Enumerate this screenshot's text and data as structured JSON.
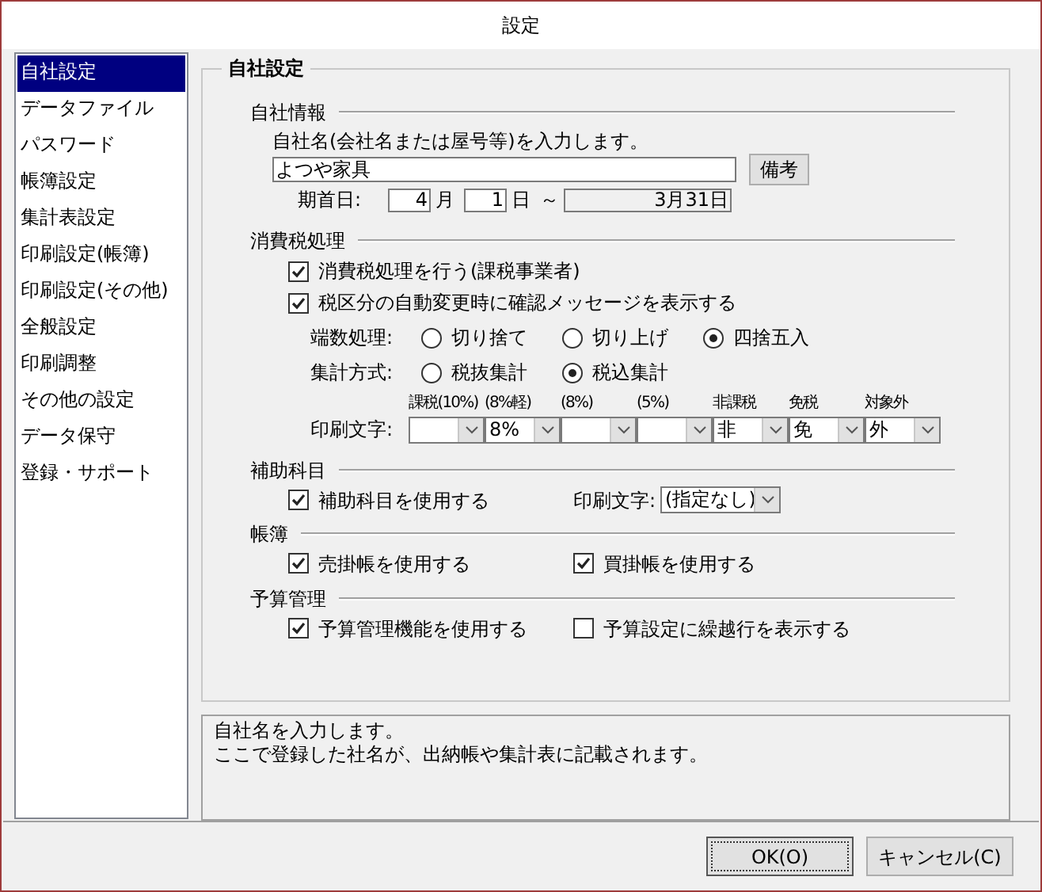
{
  "window": {
    "title": "設定"
  },
  "sidebar": {
    "items": [
      {
        "label": "自社設定",
        "selected": true
      },
      {
        "label": "データファイル",
        "selected": false
      },
      {
        "label": "パスワード",
        "selected": false
      },
      {
        "label": "帳簿設定",
        "selected": false
      },
      {
        "label": "集計表設定",
        "selected": false
      },
      {
        "label": "印刷設定(帳簿)",
        "selected": false
      },
      {
        "label": "印刷設定(その他)",
        "selected": false
      },
      {
        "label": "全般設定",
        "selected": false
      },
      {
        "label": "印刷調整",
        "selected": false
      },
      {
        "label": "その他の設定",
        "selected": false
      },
      {
        "label": "データ保守",
        "selected": false
      },
      {
        "label": "登録・サポート",
        "selected": false
      }
    ]
  },
  "panel": {
    "title": "自社設定",
    "company_info": {
      "heading": "自社情報",
      "prompt": "自社名(会社名または屋号等)を入力します。",
      "name_value": "よつや家具",
      "notes_button": "備考",
      "period_label": "期首日:",
      "start_month": "4",
      "month_unit": "月",
      "start_day": "1",
      "day_unit": "日",
      "tilde": "～",
      "end_date": "3月31日"
    },
    "tax": {
      "heading": "消費税処理",
      "checks": [
        {
          "label": "消費税処理を行う(課税事業者)",
          "checked": true
        },
        {
          "label": "税区分の自動変更時に確認メッセージを表示する",
          "checked": true
        }
      ],
      "radio_groups": [
        {
          "label": "端数処理:",
          "options": [
            {
              "label": "切り捨て",
              "selected": false
            },
            {
              "label": "切り上げ",
              "selected": false
            },
            {
              "label": "四捨五入",
              "selected": true
            }
          ]
        },
        {
          "label": "集計方式:",
          "options": [
            {
              "label": "税抜集計",
              "selected": false
            },
            {
              "label": "税込集計",
              "selected": true
            }
          ]
        }
      ],
      "print_chars": {
        "label": "印刷文字:",
        "columns": [
          {
            "header": "課税(10%)"
          },
          {
            "header": "(8%軽)",
            "value": "8%"
          },
          {
            "header": "(8%)"
          },
          {
            "header": "(5%)"
          },
          {
            "header": "非課税",
            "value": "非"
          },
          {
            "header": "免税",
            "value": "免"
          },
          {
            "header": "対象外",
            "value": "外"
          }
        ]
      }
    },
    "sub_accounts": {
      "heading": "補助科目",
      "check": {
        "label": "補助科目を使用する",
        "checked": true
      },
      "print_label": "印刷文字:",
      "print_value": "(指定なし)"
    },
    "ledgers": {
      "heading": "帳簿",
      "checks": [
        {
          "label": "売掛帳を使用する",
          "checked": true
        },
        {
          "label": "買掛帳を使用する",
          "checked": true
        }
      ]
    },
    "budget": {
      "heading": "予算管理",
      "checks": [
        {
          "label": "予算管理機能を使用する",
          "checked": true
        },
        {
          "label": "予算設定に繰越行を表示する",
          "checked": false
        }
      ]
    }
  },
  "description": [
    "自社名を入力します。",
    "ここで登録した社名が、出納帳や集計表に記載されます。"
  ],
  "buttons": [
    {
      "label": "OK(O)",
      "default": true
    },
    {
      "label": "キャンセル(C)",
      "default": false
    }
  ]
}
